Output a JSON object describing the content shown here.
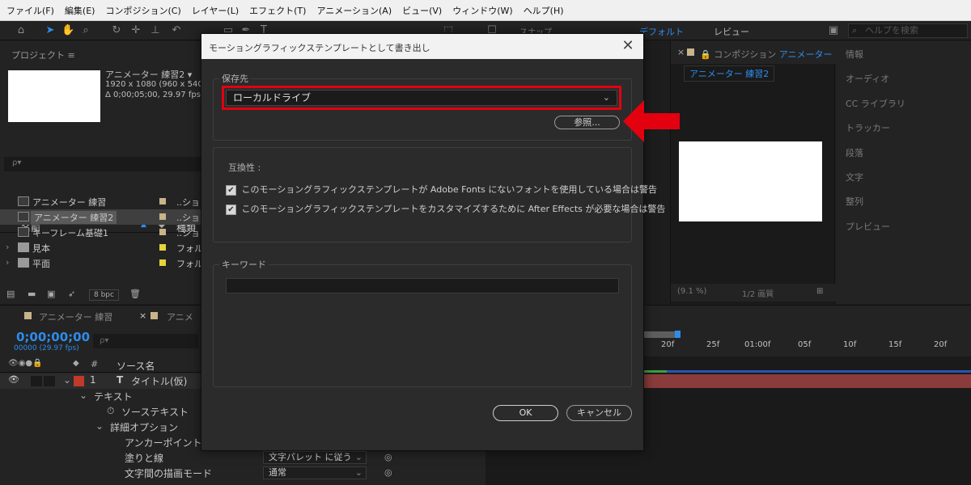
{
  "menubar": [
    "ファイル(F)",
    "編集(E)",
    "コンポジション(C)",
    "レイヤー(L)",
    "エフェクト(T)",
    "アニメーション(A)",
    "ビュー(V)",
    "ウィンドウ(W)",
    "ヘルプ(H)"
  ],
  "toolbar": {
    "snap_label": "スナップ",
    "workspace_default": "デフォルト",
    "workspace_review": "レビュー",
    "help_search_placeholder": "ヘルプを検索"
  },
  "project": {
    "title": "プロジェクト ≡",
    "selected_name": "アニメーター 練習2 ▾",
    "meta_res": "1920 x 1080  (960 x 540)",
    "meta_time": "Δ 0;00;05;00, 29.97 fps",
    "search_placeholder": "ρ▾",
    "col_name": "名前",
    "col_type": "種類",
    "items": [
      {
        "name": "アニメーター 練習",
        "type": "..ショ",
        "swatch": "#c8b48a",
        "folder": false
      },
      {
        "name": "アニメーター 練習2",
        "type": "..ショ",
        "swatch": "#c8b48a",
        "folder": false
      },
      {
        "name": "キーフレーム基礎1",
        "type": "..ショ",
        "swatch": "#c8b48a",
        "folder": false
      },
      {
        "name": "見本",
        "type": "フォル",
        "swatch": "#e5d43a",
        "folder": true
      },
      {
        "name": "平面",
        "type": "フォル",
        "swatch": "#e5d43a",
        "folder": true
      }
    ],
    "bpc": "8 bpc"
  },
  "timeline": {
    "tab1": "アニメーター 練習",
    "tab2": "アニメ",
    "timecode": "0;00;00;00",
    "timecode_sub": "00000 (29.97 fps)",
    "search_placeholder": "ρ▾",
    "col_num": "#",
    "col_source": "ソース名",
    "layer_num": "1",
    "layer_name": "タイトル(仮)",
    "rows": {
      "text": "テキスト",
      "source_text": "ソーステキスト",
      "detail_options": "詳細オプション",
      "anchor": "アンカーポイントの",
      "fill_stroke": "塗りと線",
      "blend_mode": "文字間の描画モード"
    },
    "fill_stroke_value": "文字パレット に従う",
    "blend_mode_value": "通常",
    "ruler_ticks": [
      "20f",
      "25f",
      "01:00f",
      "05f",
      "10f",
      "15f",
      "20f"
    ]
  },
  "comp": {
    "title_prefix": "コンポジション",
    "title_name": "アニメーター",
    "subtab": "アニメーター 練習2",
    "zoom": "(9.1 %)",
    "resolution": "1/2 画質"
  },
  "side_panels": [
    "情報",
    "オーディオ",
    "CC ライブラリ",
    "トラッカー",
    "段落",
    "文字",
    "整列",
    "プレビュー"
  ],
  "dialog": {
    "title": "モーショングラフィックステンプレートとして書き出し",
    "close": "✕",
    "dest_label": "保存先",
    "dest_value": "ローカルドライブ",
    "browse_label": "参照...",
    "compat_label": "互換性 :",
    "check1": "このモーショングラフィックステンプレートが Adobe Fonts にないフォントを使用している場合は警告",
    "check2": "このモーショングラフィックステンプレートをカスタマイズするために After Effects が必要な場合は警告",
    "keyword_label": "キーワード",
    "ok_label": "OK",
    "cancel_label": "キャンセル"
  },
  "colors": {
    "accent": "#2d8ceb",
    "highlight_red": "#e3000f"
  }
}
